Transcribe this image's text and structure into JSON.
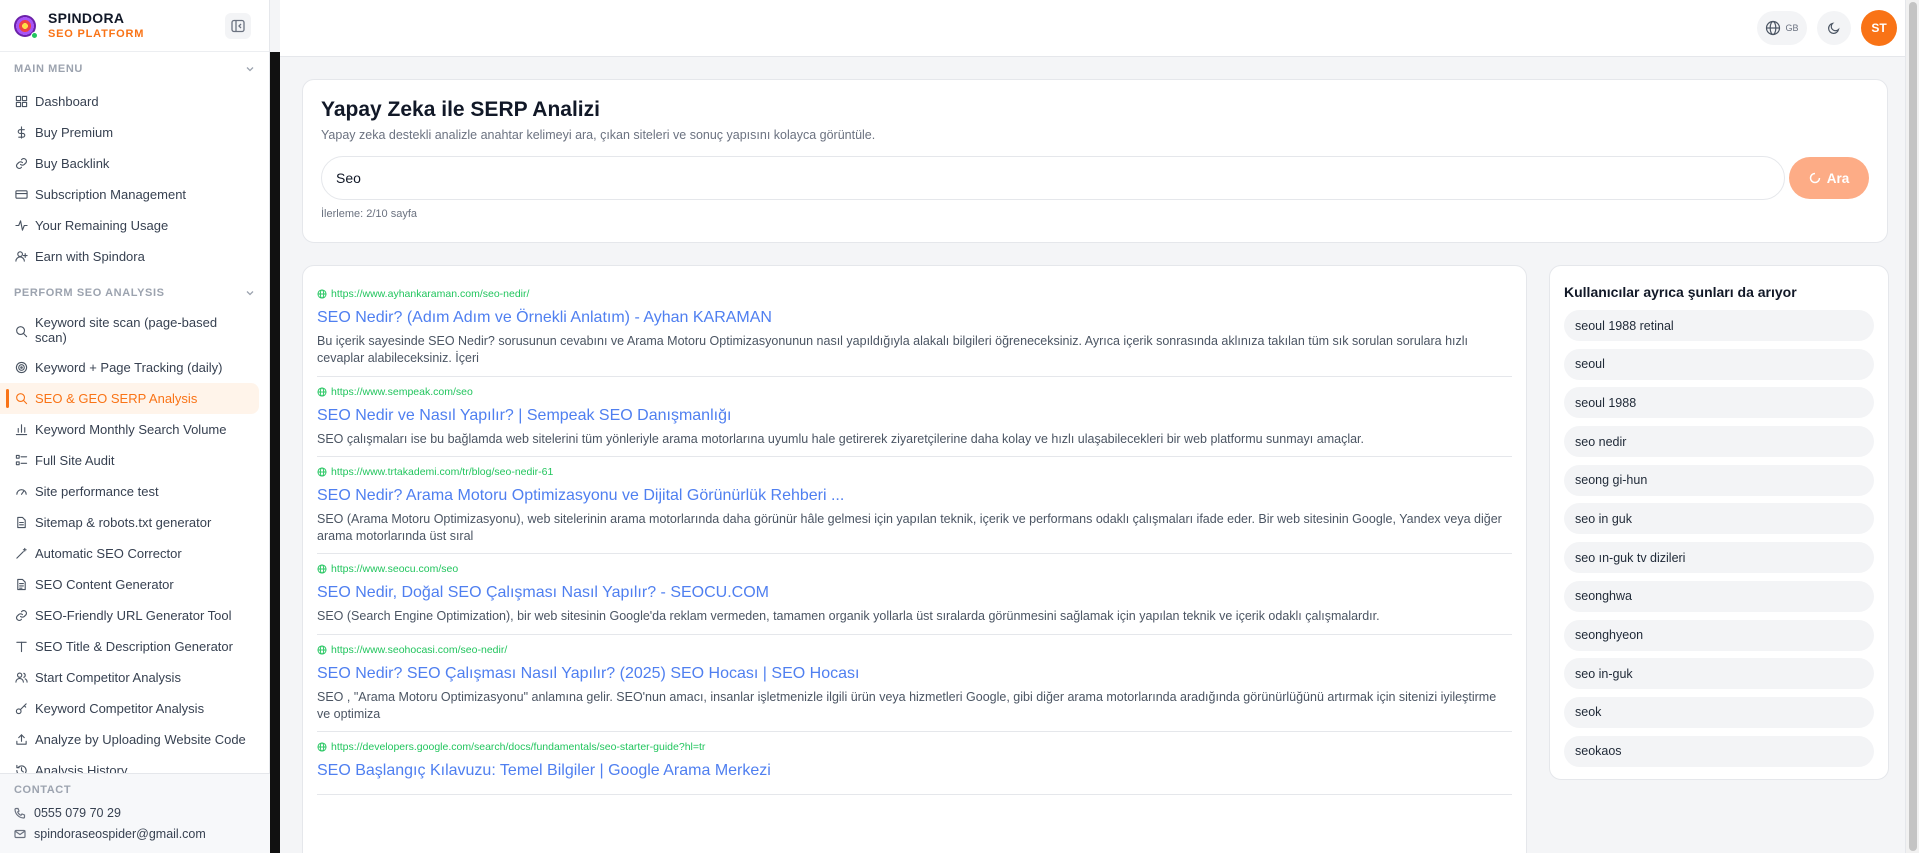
{
  "brand": {
    "name": "SPINDORA",
    "subtitle": "SEO PLATFORM"
  },
  "sidebar": {
    "main_menu": {
      "heading": "MAIN MENU",
      "items": [
        {
          "label": "Dashboard",
          "icon": "grid-icon"
        },
        {
          "label": "Buy Premium",
          "icon": "dollar-icon"
        },
        {
          "label": "Buy Backlink",
          "icon": "link-icon"
        },
        {
          "label": "Subscription Management",
          "icon": "card-icon"
        },
        {
          "label": "Your Remaining Usage",
          "icon": "activity-icon"
        },
        {
          "label": "Earn with Spindora",
          "icon": "user-plus-icon"
        }
      ]
    },
    "seo_analysis": {
      "heading": "PERFORM SEO ANALYSIS",
      "items": [
        {
          "label": "Keyword site scan (page-based scan)",
          "icon": "search-icon"
        },
        {
          "label": "Keyword + Page Tracking (daily)",
          "icon": "target-icon"
        },
        {
          "label": "SEO & GEO SERP Analysis",
          "icon": "search-icon",
          "active": true
        },
        {
          "label": "Keyword Monthly Search Volume",
          "icon": "bar-chart-icon"
        },
        {
          "label": "Full Site Audit",
          "icon": "checklist-icon"
        },
        {
          "label": "Site performance test",
          "icon": "gauge-icon"
        },
        {
          "label": "Sitemap & robots.txt generator",
          "icon": "file-icon"
        },
        {
          "label": "Automatic SEO Corrector",
          "icon": "wand-icon"
        },
        {
          "label": "SEO Content Generator",
          "icon": "document-icon"
        },
        {
          "label": "SEO-Friendly URL Generator Tool",
          "icon": "link-icon"
        },
        {
          "label": "SEO Title & Description Generator",
          "icon": "text-icon"
        },
        {
          "label": "Start Competitor Analysis",
          "icon": "users-icon"
        },
        {
          "label": "Keyword Competitor Analysis",
          "icon": "key-icon"
        },
        {
          "label": "Analyze by Uploading Website Code",
          "icon": "upload-icon"
        },
        {
          "label": "Analysis History",
          "icon": "history-icon"
        }
      ]
    },
    "contact": {
      "heading": "CONTACT",
      "phone": "0555 079 70 29",
      "email": "spindoraseospider@gmail.com"
    }
  },
  "topbar": {
    "lang": "GB",
    "avatar_initials": "ST"
  },
  "search": {
    "title": "Yapay Zeka ile SERP Analizi",
    "description": "Yapay zeka destekli analizle anahtar kelimeyi ara, çıkan siteleri ve sonuç yapısını kolayca görüntüle.",
    "query": "Seo",
    "button_label": "Ara",
    "progress": "İlerleme: 2/10 sayfa"
  },
  "results": [
    {
      "url": "https://www.ayhankaraman.com/seo-nedir/",
      "title": "SEO Nedir? (Adım Adım ve Örnekli Anlatım) - Ayhan KARAMAN",
      "snippet": "Bu içerik sayesinde SEO Nedir? sorusunun cevabını ve Arama Motoru Optimizasyonunun nasıl yapıldığıyla alakalı bilgileri öğreneceksiniz. Ayrıca içerik sonrasında aklınıza takılan tüm sık sorulan sorulara hızlı cevaplar alabileceksiniz. İçeri"
    },
    {
      "url": "https://www.sempeak.com/seo",
      "title": "SEO Nedir ve Nasıl Yapılır? | Sempeak SEO Danışmanlığı",
      "snippet": "SEO çalışmaları ise bu bağlamda web sitelerini tüm yönleriyle arama motorlarına uyumlu hale getirerek ziyaretçilerine daha kolay ve hızlı ulaşabilecekleri bir web platformu sunmayı amaçlar."
    },
    {
      "url": "https://www.trtakademi.com/tr/blog/seo-nedir-61",
      "title": "SEO Nedir? Arama Motoru Optimizasyonu ve Dijital Görünürlük Rehberi ...",
      "snippet": "SEO (Arama Motoru Optimizasyonu), web sitelerinin arama motorlarında daha görünür hâle gelmesi için yapılan teknik, içerik ve performans odaklı çalışmaları ifade eder. Bir web sitesinin Google, Yandex veya diğer arama motorlarında üst sıral"
    },
    {
      "url": "https://www.seocu.com/seo",
      "title": "SEO Nedir, Doğal SEO Çalışması Nasıl Yapılır? - SEOCU.COM",
      "snippet": "SEO (Search Engine Optimization), bir web sitesinin Google'da reklam vermeden, tamamen organik yollarla üst sıralarda görünmesini sağlamak için yapılan teknik ve içerik odaklı çalışmalardır."
    },
    {
      "url": "https://www.seohocasi.com/seo-nedir/",
      "title": "SEO Nedir? SEO Çalışması Nasıl Yapılır? (2025) SEO Hocası | SEO Hocası",
      "snippet": "SEO , \"Arama Motoru Optimizasyonu\" anlamına gelir. SEO'nun amacı, insanlar işletmenizle ilgili ürün veya hizmetleri Google, gibi diğer arama motorlarında aradığında görünürlüğünü artırmak için sitenizi iyileştirme ve optimiza"
    },
    {
      "url": "https://developers.google.com/search/docs/fundamentals/seo-starter-guide?hl=tr",
      "title": "SEO Başlangıç Kılavuzu: Temel Bilgiler | Google Arama Merkezi",
      "snippet": ""
    }
  ],
  "related": {
    "title": "Kullanıcılar ayrıca şunları da arıyor",
    "items": [
      "seoul 1988 retinal",
      "seoul",
      "seoul 1988",
      "seo nedir",
      "seong gi-hun",
      "seo in guk",
      "seo ın-guk tv dizileri",
      "seonghwa",
      "seonghyeon",
      "seo in-guk",
      "seok",
      "seokaos"
    ]
  },
  "colors": {
    "accent": "#f97316",
    "link": "#4f7ff0",
    "url": "#22c55e"
  }
}
